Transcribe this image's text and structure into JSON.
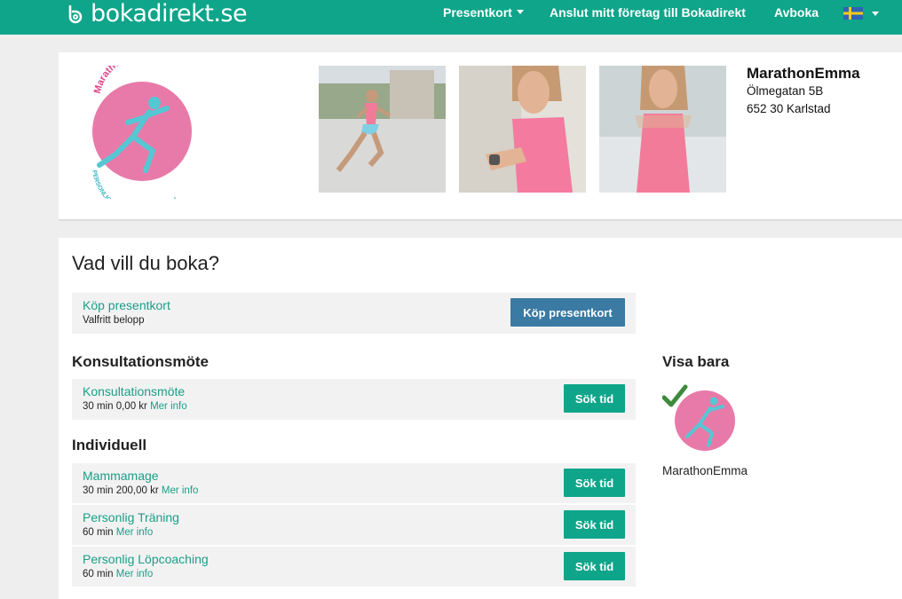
{
  "header": {
    "logo_text": "bokadirekt.se",
    "nav": {
      "gift_cards": "Presentkort",
      "connect": "Anslut mitt företag till Bokadirekt",
      "cancel": "Avboka"
    },
    "colors": {
      "brand": "#0fa58a"
    }
  },
  "company": {
    "name": "MarathonEmma",
    "street": "Ölmegatan 5B",
    "city": "652 30 Karlstad",
    "logo_text_top": "MarathonEmma",
    "logo_text_bottom": "PERSONLIG TRÄNARE & LÖPCOACH"
  },
  "booking": {
    "title": "Vad vill du boka?",
    "gift_card": {
      "name": "Köp presentkort",
      "subtitle": "Valfritt belopp",
      "button": "Köp presentkort"
    },
    "sections": [
      {
        "title": "Konsultationsmöte",
        "services": [
          {
            "name": "Konsultationsmöte",
            "details": "30 min 0,00 kr",
            "more": "Mer info",
            "button": "Sök tid"
          }
        ]
      },
      {
        "title": "Individuell",
        "services": [
          {
            "name": "Mammamage",
            "details": "30 min 200,00 kr",
            "more": "Mer info",
            "button": "Sök tid"
          },
          {
            "name": "Personlig Träning",
            "details": "60 min",
            "more": "Mer info",
            "button": "Sök tid"
          },
          {
            "name": "Personlig Löpcoaching",
            "details": "60 min",
            "more": "Mer info",
            "button": "Sök tid"
          }
        ]
      }
    ]
  },
  "filter": {
    "title": "Visa bara",
    "employee_name": "MarathonEmma",
    "selected": true
  }
}
